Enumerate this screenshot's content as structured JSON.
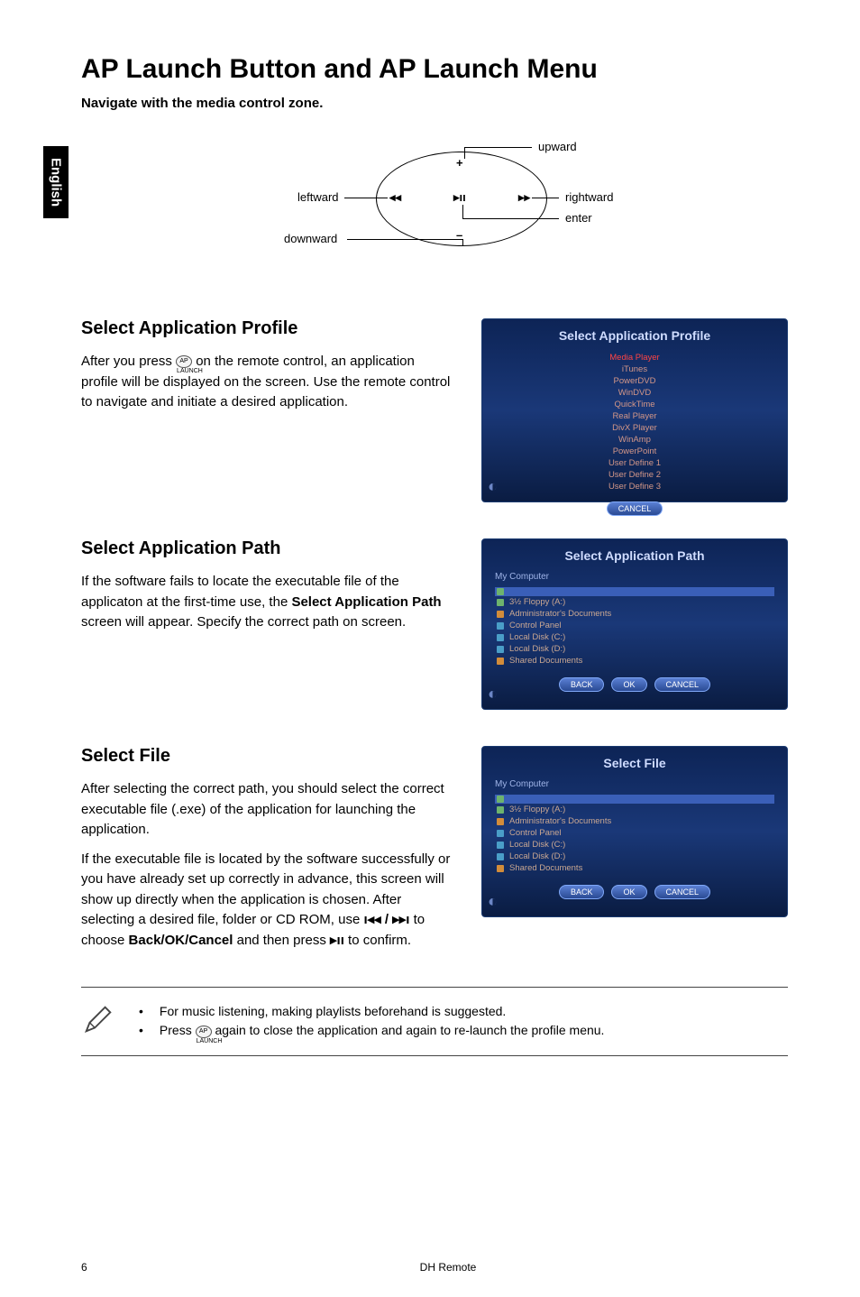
{
  "side_tab": "English",
  "title": "AP Launch Button and AP Launch Menu",
  "nav_instruction": "Navigate with the media control zone.",
  "diagram": {
    "upward": "upward",
    "leftward": "leftward",
    "rightward": "rightward",
    "enter": "enter",
    "downward": "downward",
    "plus": "+",
    "minus": "–",
    "prev": "◂◂",
    "playpause": "▸ıı",
    "next": "▸▸"
  },
  "sections": {
    "profile": {
      "title": "Select Application Profile",
      "body_before": "After you press ",
      "body_after": " on the remote control, an application profile will be displayed on the screen. Use the remote control to navigate and initiate a desired application.",
      "inline_icon_label": "AP LAUNCH",
      "window": {
        "title": "Select Application Profile",
        "items": [
          "Media Player",
          "iTunes",
          "PowerDVD",
          "WinDVD",
          "QuickTime",
          "Real Player",
          "DivX Player",
          "WinAmp",
          "PowerPoint",
          "User Define 1",
          "User Define 2",
          "User Define 3"
        ],
        "buttons": [
          "CANCEL"
        ]
      }
    },
    "path": {
      "title": "Select Application Path",
      "body": "If the software fails to locate the executable file of the applicaton at the first-time use, the ",
      "bold": "Select Application Path",
      "body_after": " screen will appear. Specify the correct path on screen.",
      "window": {
        "title": "Select Application Path",
        "breadcrumb": "My Computer",
        "rows": [
          "",
          "3½ Floppy (A:)",
          "Administrator's Documents",
          "Control Panel",
          "Local Disk (C:)",
          "Local Disk (D:)",
          "Shared Documents"
        ],
        "buttons": [
          "BACK",
          "OK",
          "CANCEL"
        ]
      }
    },
    "file": {
      "title": "Select File",
      "body1": "After selecting the correct path, you should select the correct executable file (.exe) of the application for launching the application.",
      "body2_pre": "If the executable file is located by the software successfully or you have already set up correctly in advance, this screen will show up directly when the application is chosen. After selecting a desired file, folder or CD ROM, use ",
      "prev_next": "ı◂◂ / ▸▸ı",
      "body2_mid": " to choose ",
      "back_ok_cancel": "Back/OK/Cancel",
      "body2_mid2": " and then press ",
      "play_pause": "▸ıı",
      "body2_after": " to confirm.",
      "window": {
        "title": "Select File",
        "breadcrumb": "My Computer",
        "rows": [
          "",
          "3½ Floppy (A:)",
          "Administrator's Documents",
          "Control Panel",
          "Local Disk (C:)",
          "Local Disk (D:)",
          "Shared Documents"
        ],
        "buttons": [
          "BACK",
          "OK",
          "CANCEL"
        ]
      }
    }
  },
  "notes": {
    "bullets": [
      "For music listening, making playlists beforehand is suggested.",
      {
        "pre": "Press ",
        "icon": "AP LAUNCH",
        "post": " again to close the application and again to re-launch the profile menu."
      }
    ]
  },
  "footer": {
    "page": "6",
    "title": "DH Remote"
  }
}
